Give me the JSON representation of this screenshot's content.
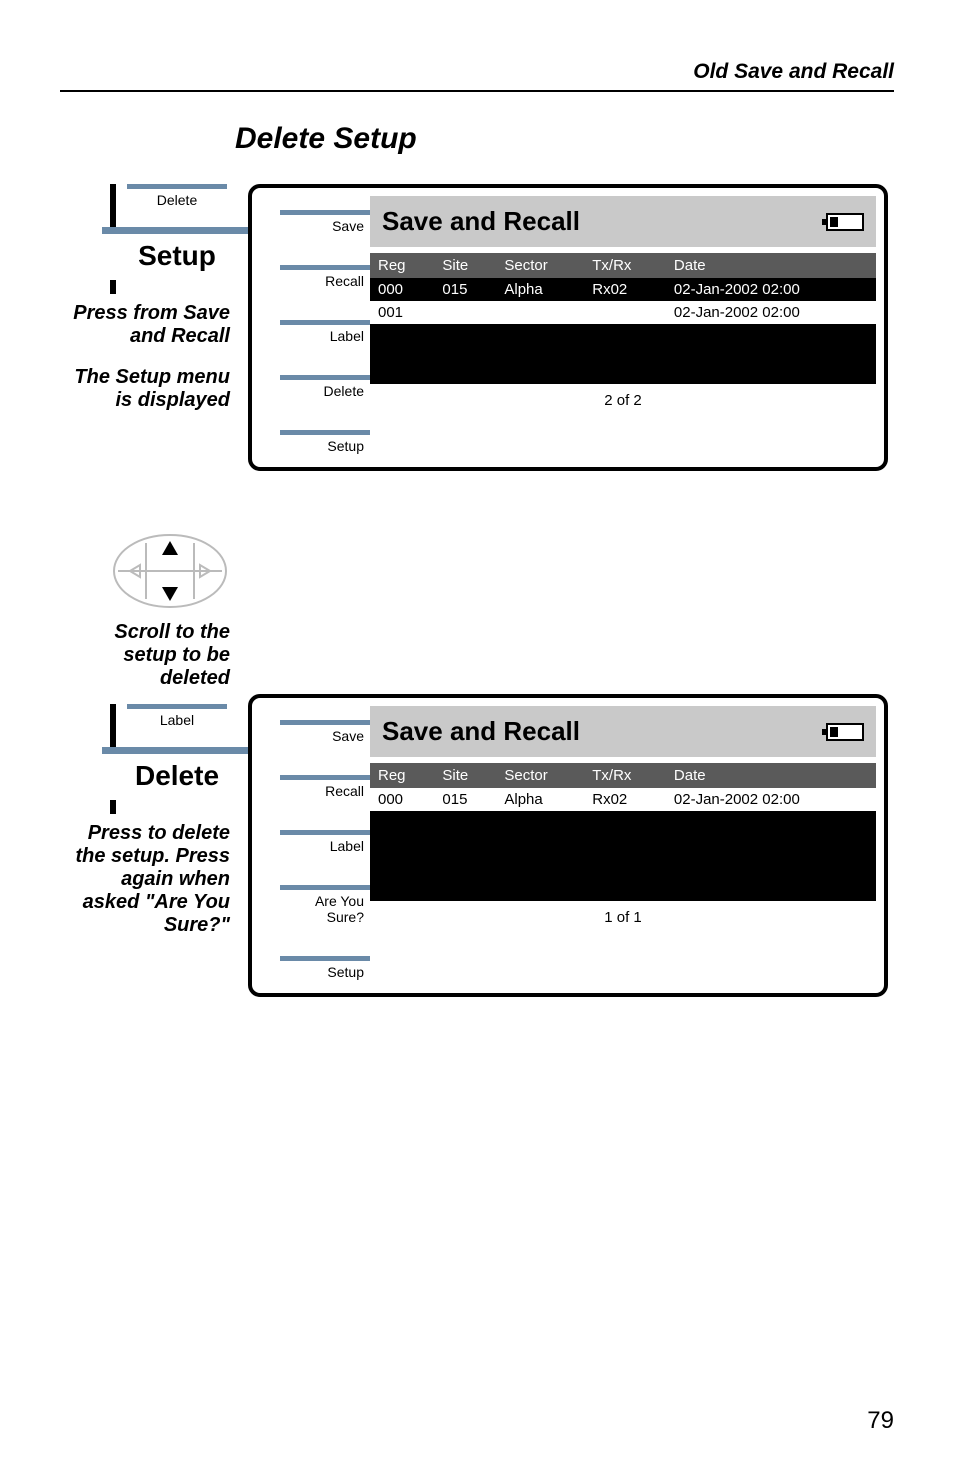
{
  "header": {
    "title": "Old Save and Recall"
  },
  "section_title": "Delete Setup",
  "block1": {
    "left": {
      "btn_small": "Delete",
      "btn_big": "Setup",
      "caption1": "Press from Save and Recall",
      "caption2": "The Setup menu is displayed"
    },
    "panel": {
      "side": {
        "b1": "Save",
        "b2": "Recall",
        "b3": "Label",
        "b4": "Delete",
        "b5": "Setup"
      },
      "title": "Save and Recall",
      "headers": {
        "reg": "Reg",
        "site": "Site",
        "sector": "Sector",
        "txrx": "Tx/Rx",
        "date": "Date"
      },
      "rows": [
        {
          "reg": "000",
          "site": "015",
          "sector": "Alpha",
          "txrx": "Rx02",
          "date": "02-Jan-2002 02:00",
          "selected": false
        },
        {
          "reg": "001",
          "site": "",
          "sector": "",
          "txrx": "",
          "date": "02-Jan-2002 02:00",
          "selected": true
        }
      ],
      "page": "2 of 2"
    }
  },
  "block2": {
    "left": {
      "caption1": "Scroll to the setup to be deleted",
      "btn_small": "Label",
      "btn_big": "Delete",
      "caption2": "Press to delete the setup. Press again when asked \"Are You Sure?\""
    },
    "panel": {
      "side": {
        "b1": "Save",
        "b2": "Recall",
        "b3": "Label",
        "b4": "Are You\nSure?",
        "b5": "Setup"
      },
      "title": "Save and Recall",
      "headers": {
        "reg": "Reg",
        "site": "Site",
        "sector": "Sector",
        "txrx": "Tx/Rx",
        "date": "Date"
      },
      "rows": [
        {
          "reg": "000",
          "site": "015",
          "sector": "Alpha",
          "txrx": "Rx02",
          "date": "02-Jan-2002 02:00",
          "selected": true
        }
      ],
      "page": "1 of 1"
    }
  },
  "page_number": "79"
}
